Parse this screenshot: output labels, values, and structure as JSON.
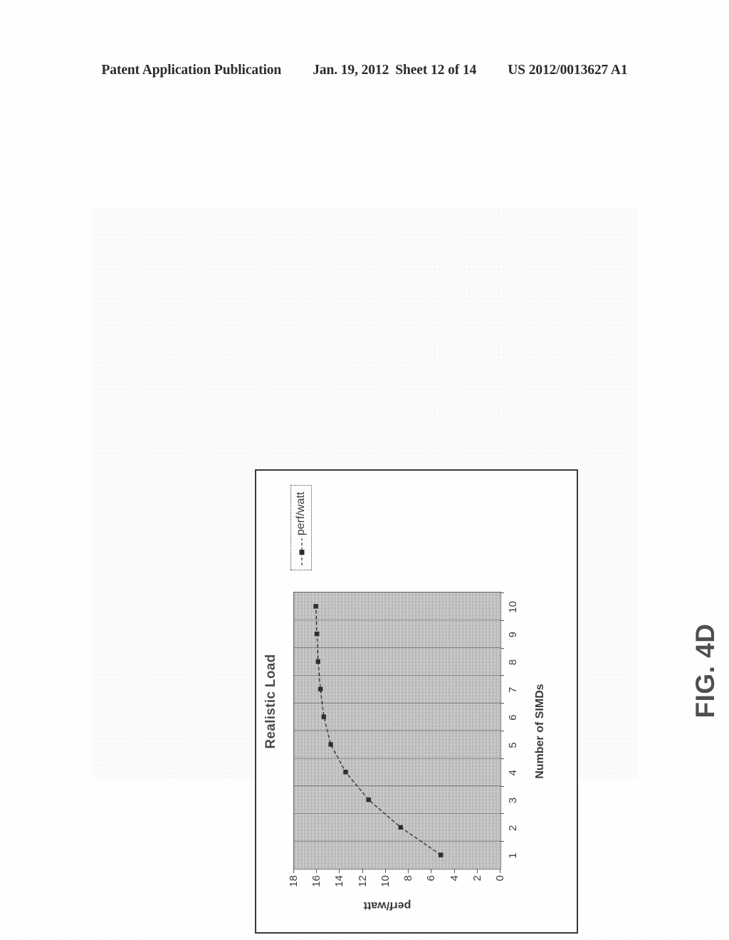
{
  "header": {
    "publication": "Patent Application Publication",
    "date": "Jan. 19, 2012",
    "sheet": "Sheet 12 of 14",
    "number": "US 2012/0013627 A1"
  },
  "figure": {
    "caption": "FIG. 4D"
  },
  "chart_data": {
    "type": "line",
    "title": "Realistic Load",
    "xlabel": "Number of SIMDs",
    "ylabel": "perf/watt",
    "categories": [
      1,
      2,
      3,
      4,
      5,
      6,
      7,
      8,
      9,
      10
    ],
    "xtick_labels": [
      "1",
      "2",
      "3",
      "4",
      "5",
      "6",
      "7",
      "8",
      "9",
      "10"
    ],
    "ytick_labels": [
      "0",
      "2",
      "4",
      "6",
      "8",
      "10",
      "12",
      "14",
      "16",
      "18"
    ],
    "ytick_values": [
      0,
      2,
      4,
      6,
      8,
      10,
      12,
      14,
      16,
      18
    ],
    "ylim": [
      0,
      18
    ],
    "grid": "vertical-major",
    "plot_background": "#c9c9c9",
    "series": [
      {
        "name": "perf/watt",
        "marker": "square",
        "line_style": "dashed",
        "color": "#3c3c3c",
        "values": [
          5.2,
          8.7,
          11.5,
          13.5,
          14.8,
          15.4,
          15.7,
          15.9,
          16.0,
          16.1
        ]
      }
    ],
    "legend": {
      "position": "top-right",
      "entries": [
        "perf/watt"
      ]
    }
  }
}
